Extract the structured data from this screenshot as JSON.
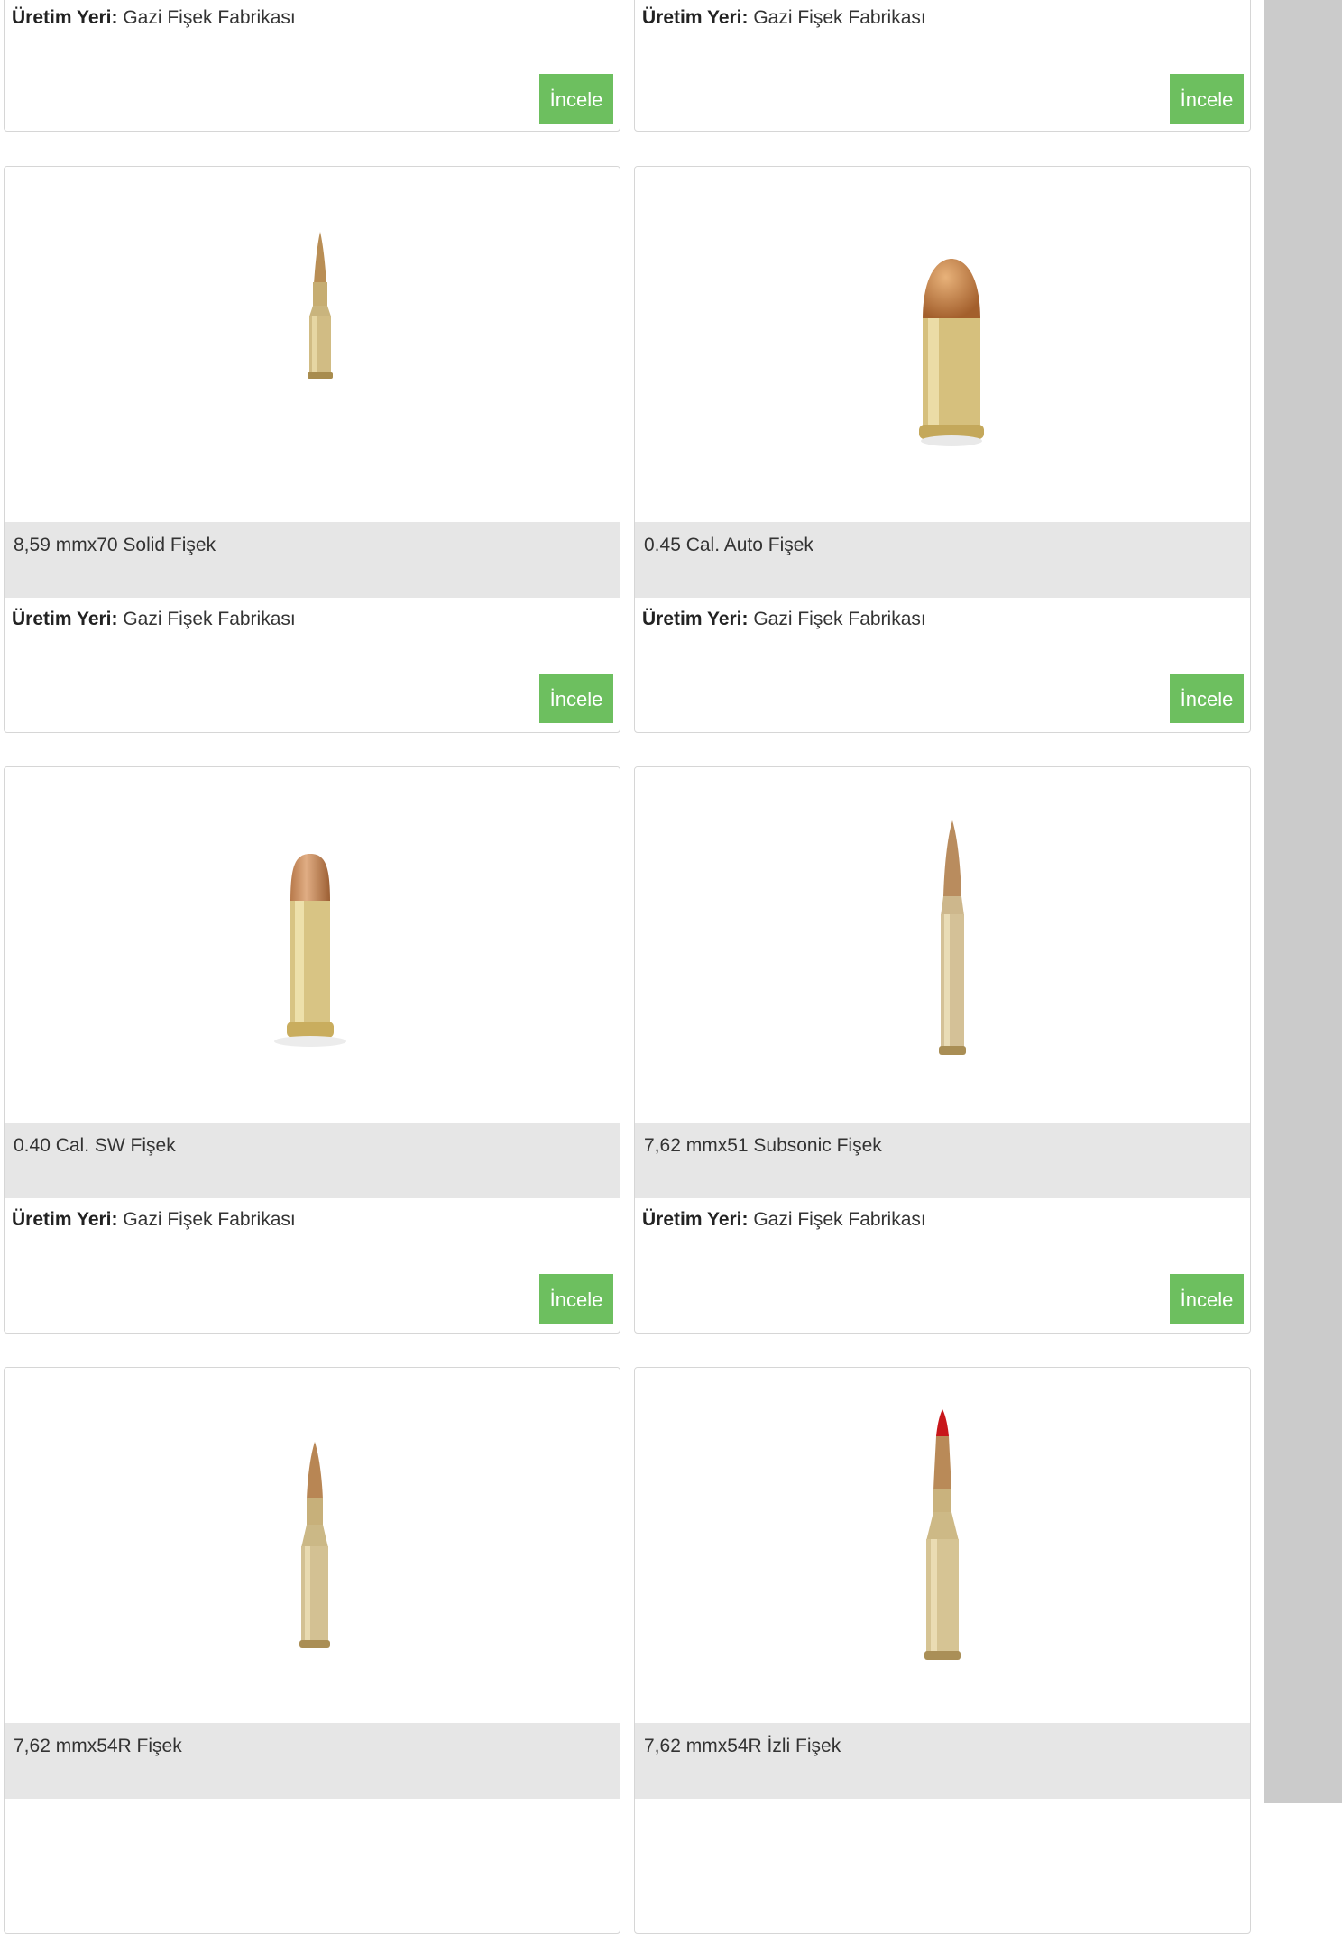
{
  "labels": {
    "origin_label": "Üretim Yeri:",
    "button_label": "İncele"
  },
  "products": [
    {
      "name": "",
      "origin": "Gazi Fişek Fabrikası"
    },
    {
      "name": "",
      "origin": "Gazi Fişek Fabrikası"
    },
    {
      "name": "8,59 mmx70 Solid Fişek",
      "origin": "Gazi Fişek Fabrikası",
      "image": "rifle-cartridge-icon"
    },
    {
      "name": "0.45 Cal. Auto Fişek",
      "origin": "Gazi Fişek Fabrikası",
      "image": "pistol-cartridge-icon"
    },
    {
      "name": "0.40 Cal. SW Fişek",
      "origin": "Gazi Fişek Fabrikası",
      "image": "pistol-cartridge-icon"
    },
    {
      "name": "7,62 mmx51 Subsonic Fişek",
      "origin": "Gazi Fişek Fabrikası",
      "image": "rifle-cartridge-icon"
    },
    {
      "name": "7,62 mmx54R Fişek",
      "origin": "",
      "image": "rifle-cartridge-icon"
    },
    {
      "name": "7,62 mmx54R İzli Fişek",
      "origin": "",
      "image": "tracer-cartridge-icon"
    }
  ],
  "colors": {
    "button": "#6dbf5f",
    "title_bar": "#e6e6e6",
    "scrollbar": "#cbcbcb"
  }
}
